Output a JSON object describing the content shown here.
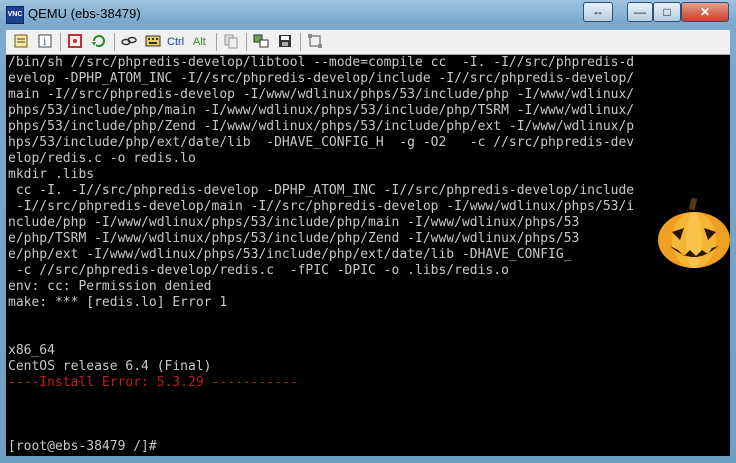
{
  "window": {
    "title": "QEMU (ebs-38479)",
    "app_icon_text": "VNC"
  },
  "titlebar": {
    "extra_glyph": "⇔",
    "min_glyph": "—",
    "max_glyph": "□",
    "close_glyph": "✕"
  },
  "toolbar": {
    "ctrl_label": "Ctrl",
    "alt_label": "Alt"
  },
  "terminal": {
    "lines": [
      "/bin/sh //src/phpredis-develop/libtool --mode=compile cc  -I. -I//src/phpredis-d",
      "evelop -DPHP_ATOM_INC -I//src/phpredis-develop/include -I//src/phpredis-develop/",
      "main -I//src/phpredis-develop -I/www/wdlinux/phps/53/include/php -I/www/wdlinux/",
      "phps/53/include/php/main -I/www/wdlinux/phps/53/include/php/TSRM -I/www/wdlinux/",
      "phps/53/include/php/Zend -I/www/wdlinux/phps/53/include/php/ext -I/www/wdlinux/p",
      "hps/53/include/php/ext/date/lib  -DHAVE_CONFIG_H  -g -O2   -c //src/phpredis-dev",
      "elop/redis.c -o redis.lo",
      "mkdir .libs",
      " cc -I. -I//src/phpredis-develop -DPHP_ATOM_INC -I//src/phpredis-develop/include",
      " -I//src/phpredis-develop/main -I//src/phpredis-develop -I/www/wdlinux/phps/53/i",
      "nclude/php -I/www/wdlinux/phps/53/include/php/main -I/www/wdlinux/phps/53",
      "e/php/TSRM -I/www/wdlinux/phps/53/include/php/Zend -I/www/wdlinux/phps/53",
      "e/php/ext -I/www/wdlinux/phps/53/include/php/ext/date/lib -DHAVE_CONFIG_",
      " -c //src/phpredis-develop/redis.c  -fPIC -DPIC -o .libs/redis.o",
      "env: cc: Permission denied",
      "make: *** [redis.lo] Error 1",
      "",
      "",
      "x86_64",
      "CentOS release 6.4 (Final)",
      "----Install Error: 5.3.29 -----------",
      "",
      "",
      "",
      "[root@ebs-38479 /]#"
    ]
  }
}
